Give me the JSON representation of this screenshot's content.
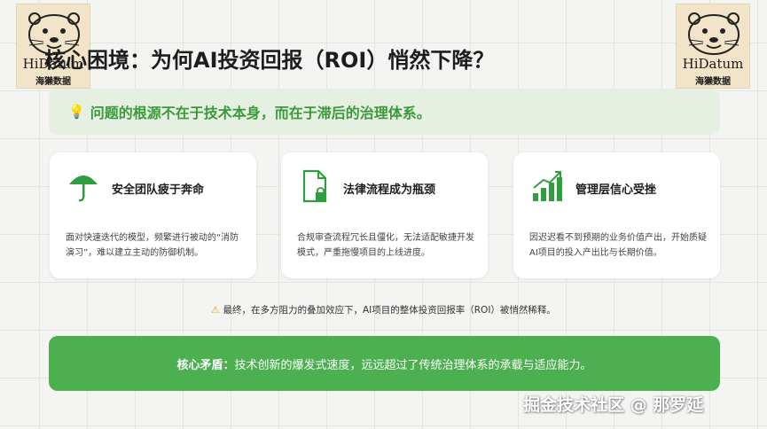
{
  "logo": {
    "brand": "HiDatum",
    "brand_cn": "海獭数据"
  },
  "slide": {
    "title": "核心困境：为何AI投资回报（ROI）悄然下降？",
    "banner": "问题的根源不在于技术本身，而在于滞后的治理体系。",
    "cards": [
      {
        "icon": "umbrella-icon",
        "title": "安全团队疲于奔命",
        "body": "面对快速迭代的模型，频繁进行被动的“消防演习”，难以建立主动的防御机制。"
      },
      {
        "icon": "document-lock-icon",
        "title": "法律流程成为瓶颈",
        "body": "合规审查流程冗长且僵化，无法适配敏捷开发模式，严重拖慢项目的上线进度。"
      },
      {
        "icon": "growth-chart-icon",
        "title": "管理层信心受挫",
        "body": "因迟迟看不到预期的业务价值产出，开始质疑AI项目的投入产出比与长期价值。"
      }
    ],
    "warning": "最终，在多方阻力的叠加效应下，AI项目的整体投资回报率（ROI）被悄然稀释。",
    "core_label": "核心矛盾：",
    "core_text": "技术创新的爆发式速度，远远超过了传统治理体系的承载与适应能力。"
  },
  "watermark": "掘金技术社区 @ 那罗延",
  "colors": {
    "accent": "#4caf50",
    "banner_bg": "#e6f0e2",
    "icon_green": "#2e9e3e",
    "banner_text": "#3a9a3a"
  }
}
